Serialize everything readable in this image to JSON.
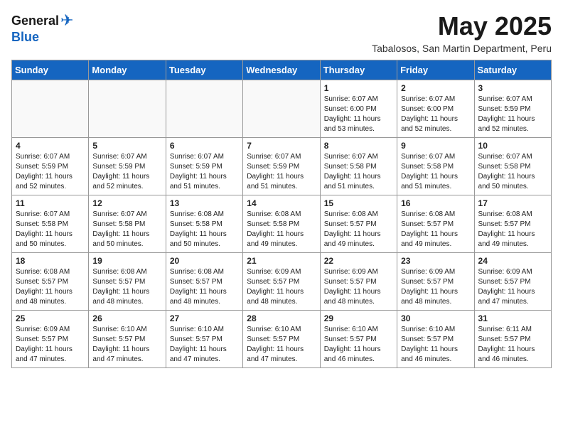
{
  "header": {
    "logo_general": "General",
    "logo_blue": "Blue",
    "month_title": "May 2025",
    "subtitle": "Tabalosos, San Martin Department, Peru"
  },
  "weekdays": [
    "Sunday",
    "Monday",
    "Tuesday",
    "Wednesday",
    "Thursday",
    "Friday",
    "Saturday"
  ],
  "weeks": [
    [
      {
        "day": "",
        "info": ""
      },
      {
        "day": "",
        "info": ""
      },
      {
        "day": "",
        "info": ""
      },
      {
        "day": "",
        "info": ""
      },
      {
        "day": "1",
        "info": "Sunrise: 6:07 AM\nSunset: 6:00 PM\nDaylight: 11 hours\nand 53 minutes."
      },
      {
        "day": "2",
        "info": "Sunrise: 6:07 AM\nSunset: 6:00 PM\nDaylight: 11 hours\nand 52 minutes."
      },
      {
        "day": "3",
        "info": "Sunrise: 6:07 AM\nSunset: 5:59 PM\nDaylight: 11 hours\nand 52 minutes."
      }
    ],
    [
      {
        "day": "4",
        "info": "Sunrise: 6:07 AM\nSunset: 5:59 PM\nDaylight: 11 hours\nand 52 minutes."
      },
      {
        "day": "5",
        "info": "Sunrise: 6:07 AM\nSunset: 5:59 PM\nDaylight: 11 hours\nand 52 minutes."
      },
      {
        "day": "6",
        "info": "Sunrise: 6:07 AM\nSunset: 5:59 PM\nDaylight: 11 hours\nand 51 minutes."
      },
      {
        "day": "7",
        "info": "Sunrise: 6:07 AM\nSunset: 5:59 PM\nDaylight: 11 hours\nand 51 minutes."
      },
      {
        "day": "8",
        "info": "Sunrise: 6:07 AM\nSunset: 5:58 PM\nDaylight: 11 hours\nand 51 minutes."
      },
      {
        "day": "9",
        "info": "Sunrise: 6:07 AM\nSunset: 5:58 PM\nDaylight: 11 hours\nand 51 minutes."
      },
      {
        "day": "10",
        "info": "Sunrise: 6:07 AM\nSunset: 5:58 PM\nDaylight: 11 hours\nand 50 minutes."
      }
    ],
    [
      {
        "day": "11",
        "info": "Sunrise: 6:07 AM\nSunset: 5:58 PM\nDaylight: 11 hours\nand 50 minutes."
      },
      {
        "day": "12",
        "info": "Sunrise: 6:07 AM\nSunset: 5:58 PM\nDaylight: 11 hours\nand 50 minutes."
      },
      {
        "day": "13",
        "info": "Sunrise: 6:08 AM\nSunset: 5:58 PM\nDaylight: 11 hours\nand 50 minutes."
      },
      {
        "day": "14",
        "info": "Sunrise: 6:08 AM\nSunset: 5:58 PM\nDaylight: 11 hours\nand 49 minutes."
      },
      {
        "day": "15",
        "info": "Sunrise: 6:08 AM\nSunset: 5:57 PM\nDaylight: 11 hours\nand 49 minutes."
      },
      {
        "day": "16",
        "info": "Sunrise: 6:08 AM\nSunset: 5:57 PM\nDaylight: 11 hours\nand 49 minutes."
      },
      {
        "day": "17",
        "info": "Sunrise: 6:08 AM\nSunset: 5:57 PM\nDaylight: 11 hours\nand 49 minutes."
      }
    ],
    [
      {
        "day": "18",
        "info": "Sunrise: 6:08 AM\nSunset: 5:57 PM\nDaylight: 11 hours\nand 48 minutes."
      },
      {
        "day": "19",
        "info": "Sunrise: 6:08 AM\nSunset: 5:57 PM\nDaylight: 11 hours\nand 48 minutes."
      },
      {
        "day": "20",
        "info": "Sunrise: 6:08 AM\nSunset: 5:57 PM\nDaylight: 11 hours\nand 48 minutes."
      },
      {
        "day": "21",
        "info": "Sunrise: 6:09 AM\nSunset: 5:57 PM\nDaylight: 11 hours\nand 48 minutes."
      },
      {
        "day": "22",
        "info": "Sunrise: 6:09 AM\nSunset: 5:57 PM\nDaylight: 11 hours\nand 48 minutes."
      },
      {
        "day": "23",
        "info": "Sunrise: 6:09 AM\nSunset: 5:57 PM\nDaylight: 11 hours\nand 48 minutes."
      },
      {
        "day": "24",
        "info": "Sunrise: 6:09 AM\nSunset: 5:57 PM\nDaylight: 11 hours\nand 47 minutes."
      }
    ],
    [
      {
        "day": "25",
        "info": "Sunrise: 6:09 AM\nSunset: 5:57 PM\nDaylight: 11 hours\nand 47 minutes."
      },
      {
        "day": "26",
        "info": "Sunrise: 6:10 AM\nSunset: 5:57 PM\nDaylight: 11 hours\nand 47 minutes."
      },
      {
        "day": "27",
        "info": "Sunrise: 6:10 AM\nSunset: 5:57 PM\nDaylight: 11 hours\nand 47 minutes."
      },
      {
        "day": "28",
        "info": "Sunrise: 6:10 AM\nSunset: 5:57 PM\nDaylight: 11 hours\nand 47 minutes."
      },
      {
        "day": "29",
        "info": "Sunrise: 6:10 AM\nSunset: 5:57 PM\nDaylight: 11 hours\nand 46 minutes."
      },
      {
        "day": "30",
        "info": "Sunrise: 6:10 AM\nSunset: 5:57 PM\nDaylight: 11 hours\nand 46 minutes."
      },
      {
        "day": "31",
        "info": "Sunrise: 6:11 AM\nSunset: 5:57 PM\nDaylight: 11 hours\nand 46 minutes."
      }
    ]
  ]
}
